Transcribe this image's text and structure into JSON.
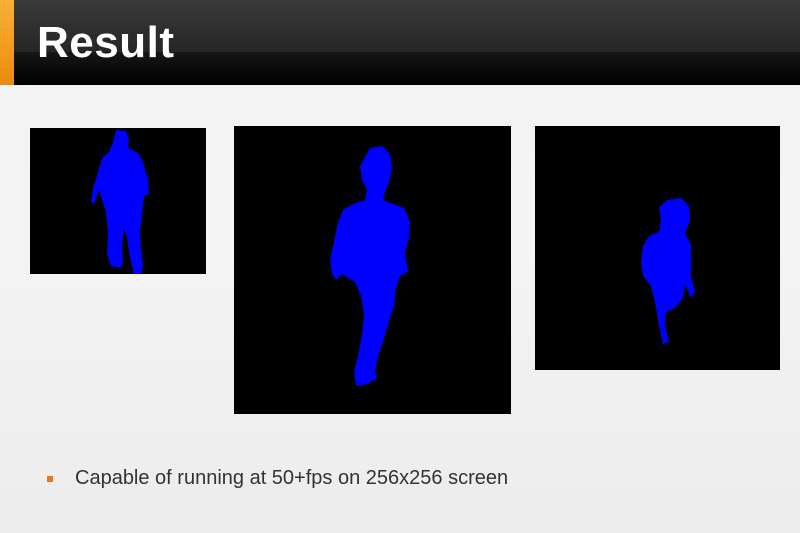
{
  "slide": {
    "title": "Result"
  },
  "figures": [
    {
      "name": "segmentation-result-1",
      "background": "#000000",
      "mask_color": "#0000ff"
    },
    {
      "name": "segmentation-result-2",
      "background": "#000000",
      "mask_color": "#0000ff"
    },
    {
      "name": "segmentation-result-3",
      "background": "#000000",
      "mask_color": "#0000ff"
    }
  ],
  "bullets": [
    {
      "text": "Capable of running at 50+fps on 256x256 screen",
      "marker_color": "#e8781e"
    }
  ],
  "colors": {
    "accent": "#f39a1c",
    "title_bar": "#1a1a1a",
    "text": "#333333"
  }
}
